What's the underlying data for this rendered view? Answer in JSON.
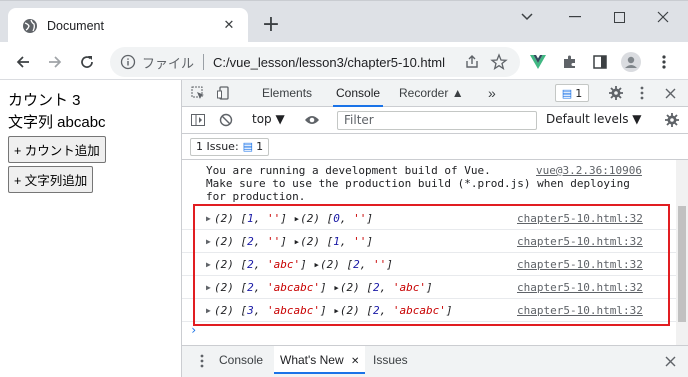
{
  "browser": {
    "tab_title": "Document",
    "url_scheme_label": "ファイル",
    "url": "C:/vue_lesson/lesson3/chapter5-10.html"
  },
  "page": {
    "count_label": "カウント 3",
    "string_label": "文字列 abcabc",
    "count_button": "+ カウント追加",
    "string_button": "+ 文字列追加"
  },
  "devtools": {
    "tabs": [
      "Elements",
      "Console",
      "Recorder ▲"
    ],
    "active_tab": "Console",
    "issues_badge_count": "1",
    "context": "top ▼",
    "filter_placeholder": "Filter",
    "levels": "Default levels ▼",
    "issue_pill": "1 Issue:",
    "issue_pill_count": "1",
    "vue_message": "You are running a development build of Vue.\nMake sure to use the production build (*.prod.js) when deploying\nfor production.",
    "vue_message_source": "vue@3.2.36:10906",
    "logs": [
      {
        "text": "(2) [1, ''] ▸(2) [0, '']",
        "source": "chapter5-10.html:32"
      },
      {
        "text": "(2) [2, ''] ▸(2) [1, '']",
        "source": "chapter5-10.html:32"
      },
      {
        "text": "(2) [2, 'abc'] ▸(2) [2, '']",
        "source": "chapter5-10.html:32"
      },
      {
        "text": "(2) [2, 'abcabc'] ▸(2) [2, 'abc']",
        "source": "chapter5-10.html:32"
      },
      {
        "text": "(2) [3, 'abcabc'] ▸(2) [2, 'abcabc']",
        "source": "chapter5-10.html:32"
      }
    ],
    "drawer_tabs": [
      "Console",
      "What's New",
      "Issues"
    ],
    "drawer_active": "What's New"
  },
  "colors": {
    "accent": "#1a73e8",
    "highlight": "#e11d21",
    "vue_green": "#41b883"
  }
}
